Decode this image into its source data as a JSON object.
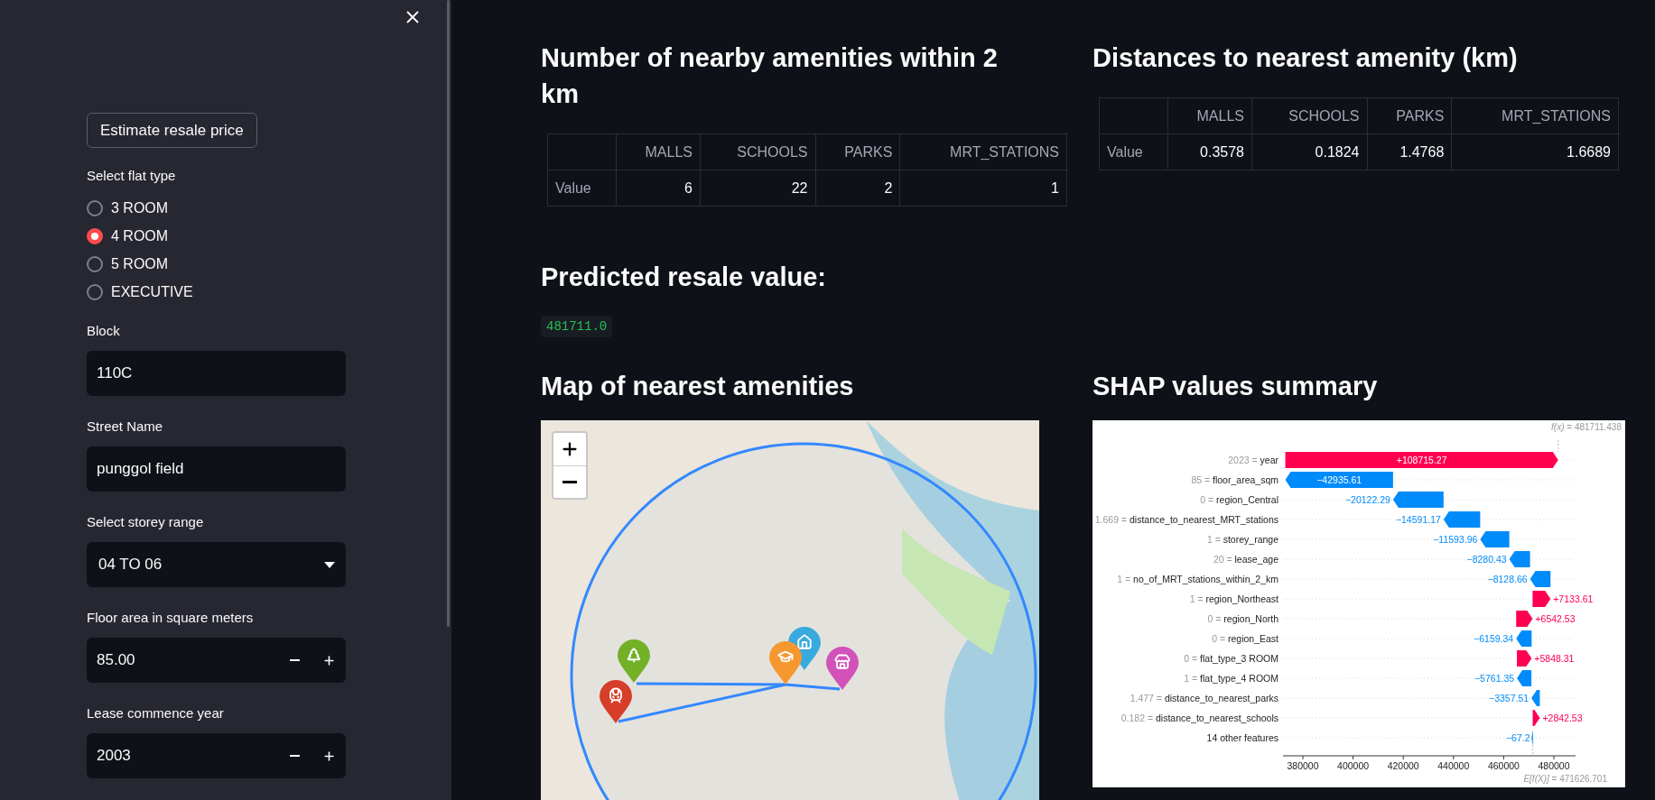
{
  "sidebar": {
    "button": "Estimate resale price",
    "flat_type": {
      "label": "Select flat type",
      "options": [
        {
          "label": "3 ROOM",
          "selected": false
        },
        {
          "label": "4 ROOM",
          "selected": true
        },
        {
          "label": "5 ROOM",
          "selected": false
        },
        {
          "label": "EXECUTIVE",
          "selected": false
        }
      ]
    },
    "fields": [
      {
        "kind": "text",
        "label": "Block",
        "value": "110C"
      },
      {
        "kind": "text",
        "label": "Street Name",
        "value": "punggol field"
      },
      {
        "kind": "select",
        "label": "Select storey range",
        "value": "04 TO 06"
      },
      {
        "kind": "number",
        "label": "Floor area in square meters",
        "value": "85.00"
      },
      {
        "kind": "number",
        "label": "Lease commence year",
        "value": "2003"
      }
    ]
  },
  "main": {
    "amenity_counts": {
      "title": "Number of nearby amenities within 2 km",
      "columns": [
        "MALLS",
        "SCHOOLS",
        "PARKS",
        "MRT_STATIONS"
      ],
      "rows": [
        {
          "label": "Value",
          "cells": [
            "6",
            "22",
            "2",
            "1"
          ]
        }
      ]
    },
    "distances": {
      "title": "Distances to nearest amenity (km)",
      "columns": [
        "MALLS",
        "SCHOOLS",
        "PARKS",
        "MRT_STATIONS"
      ],
      "rows": [
        {
          "label": "Value",
          "cells": [
            "0.3578",
            "0.1824",
            "1.4768",
            "1.6689"
          ]
        }
      ]
    },
    "prediction": {
      "title": "Predicted resale value:",
      "value": "481711.0"
    },
    "map": {
      "title": "Map of nearest amenities"
    },
    "shap": {
      "title": "SHAP values summary",
      "output_label": "*f(x)* = 481711.438",
      "base_label": "*E[f(X)]* = 471626.701",
      "rows": [
        {
          "value": "2023 =",
          "feature": "year",
          "kind": "positive",
          "contribution": "+108715.27"
        },
        {
          "value": "85 =",
          "feature": "floor_area_sqm",
          "kind": "negative",
          "contribution": "−42935.61"
        },
        {
          "value": "0 =",
          "feature": "region_Central",
          "kind": "negative",
          "contribution": "−20122.29"
        },
        {
          "value": "1.669 =",
          "feature": "distance_to_nearest_MRT_stations",
          "kind": "negative",
          "contribution": "−14591.17"
        },
        {
          "value": "1 =",
          "feature": "storey_range",
          "kind": "negative",
          "contribution": "−11593.96"
        },
        {
          "value": "20 =",
          "feature": "lease_age",
          "kind": "negative",
          "contribution": "−8280.43"
        },
        {
          "value": "1 =",
          "feature": "no_of_MRT_stations_within_2_km",
          "kind": "negative",
          "contribution": "−8128.66"
        },
        {
          "value": "1 =",
          "feature": "region_Northeast",
          "kind": "positive",
          "contribution": "+7133.61"
        },
        {
          "value": "0 =",
          "feature": "region_North",
          "kind": "positive",
          "contribution": "+6542.53"
        },
        {
          "value": "0 =",
          "feature": "region_East",
          "kind": "negative",
          "contribution": "−6159.34"
        },
        {
          "value": "0 =",
          "feature": "flat_type_3 ROOM",
          "kind": "positive",
          "contribution": "+5848.31"
        },
        {
          "value": "1 =",
          "feature": "flat_type_4 ROOM",
          "kind": "negative",
          "contribution": "−5761.35"
        },
        {
          "value": "1.477 =",
          "feature": "distance_to_nearest_parks",
          "kind": "negative",
          "contribution": "−3357.51"
        },
        {
          "value": "0.182 =",
          "feature": "distance_to_nearest_schools",
          "kind": "positive",
          "contribution": "+2842.53"
        },
        {
          "feature": "14 other features",
          "kind": "negative",
          "contribution": "−67.2"
        }
      ],
      "axis_ticks": [
        "380000",
        "400000",
        "420000",
        "440000",
        "460000",
        "480000"
      ]
    }
  }
}
